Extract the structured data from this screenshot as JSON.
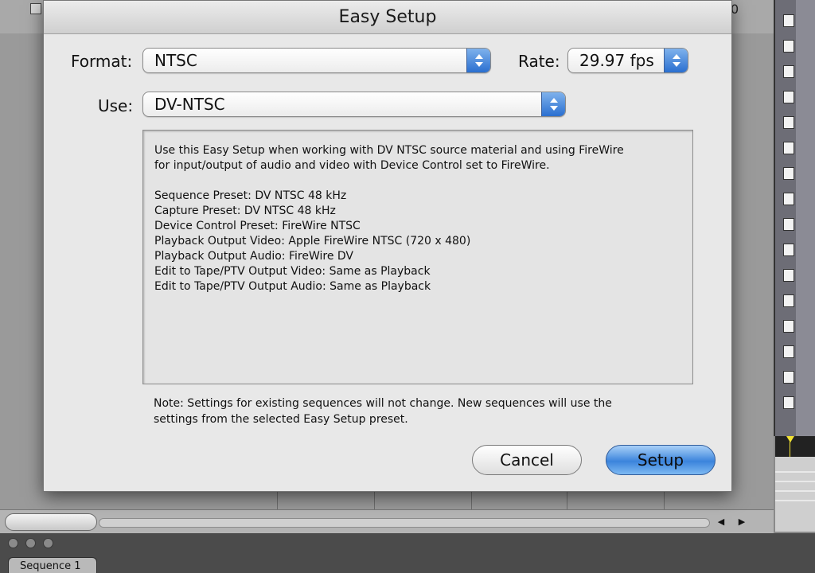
{
  "background_app": {
    "header_number": "0",
    "sequence_tab_label": "Sequence 1"
  },
  "dialog": {
    "title": "Easy Setup",
    "format": {
      "label": "Format:",
      "value": "NTSC"
    },
    "rate": {
      "label": "Rate:",
      "value": "29.97 fps"
    },
    "use": {
      "label": "Use:",
      "value": "DV-NTSC"
    },
    "description": {
      "intro": [
        "Use this Easy Setup when working with DV NTSC source material and using FireWire",
        "for input/output of audio and video with Device Control set to FireWire."
      ],
      "presets": [
        "Sequence Preset: DV NTSC 48 kHz",
        "Capture Preset: DV NTSC 48 kHz",
        "Device Control Preset: FireWire NTSC",
        "Playback Output Video: Apple FireWire NTSC (720 x 480)",
        "Playback Output Audio: FireWire DV",
        "Edit to Tape/PTV Output Video: Same as Playback",
        "Edit to Tape/PTV Output Audio: Same as Playback"
      ]
    },
    "note": [
      "Note: Settings for existing sequences will not change. New sequences will use the",
      "settings from the selected Easy Setup preset."
    ],
    "buttons": {
      "cancel": "Cancel",
      "setup": "Setup"
    }
  },
  "colors": {
    "default_button_accent": "#3b84dc",
    "popup_stepper": "#2a6fd0",
    "dialog_background": "#e8e8e8"
  }
}
